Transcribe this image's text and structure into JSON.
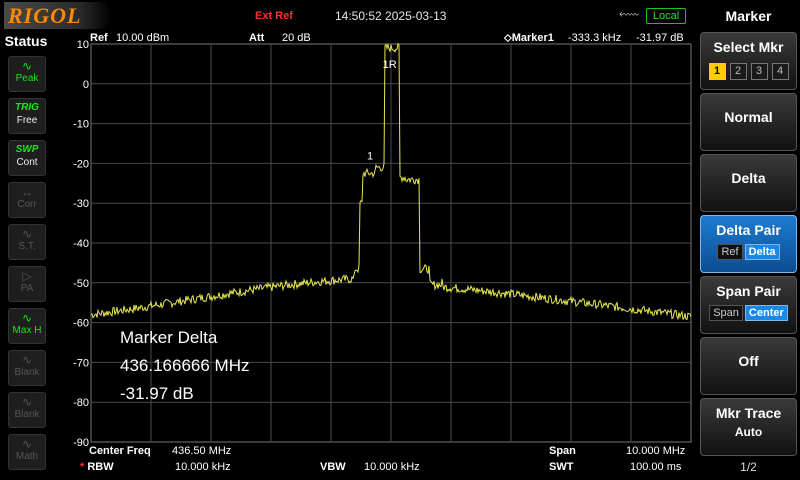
{
  "topbar": {
    "logo": "RIGOL",
    "ext_ref": "Ext Ref",
    "datetime": "14:50:52 2025-03-13",
    "usb_icon": "usb-icon",
    "local": "Local"
  },
  "status": {
    "title": "Status",
    "items": [
      {
        "icon": "peak-icon",
        "label": "Peak",
        "state": "on"
      },
      {
        "tag": "TRIG",
        "label": "Free"
      },
      {
        "tag": "SWP",
        "label": "Cont"
      },
      {
        "icon": "corr-icon",
        "label": "Corr",
        "state": "off"
      },
      {
        "icon": "st-icon",
        "label": "S.T.",
        "state": "off"
      },
      {
        "icon": "pa-icon",
        "label": "PA",
        "state": "off"
      },
      {
        "icon": "maxhold-icon",
        "label": "Max H",
        "state": "on"
      },
      {
        "icon": "blank-icon",
        "label": "Blank",
        "state": "off"
      },
      {
        "icon": "blank-icon",
        "label": "Blank",
        "state": "off"
      },
      {
        "icon": "math-icon",
        "label": "Math",
        "state": "off"
      }
    ]
  },
  "header": {
    "ref_label": "Ref",
    "ref_value": "10.00 dBm",
    "att_label": "Att",
    "att_value": "20 dB",
    "marker_label": "Marker1",
    "marker_freq": "-333.3 kHz",
    "marker_amp": "-31.97 dB"
  },
  "yaxis": {
    "ticks": [
      "10",
      "0",
      "-10",
      "-20",
      "-30",
      "-40",
      "-50",
      "-60",
      "-70",
      "-80",
      "-90"
    ],
    "ref_dbm": 10,
    "div_db": 10,
    "divisions": 10
  },
  "marker_delta": {
    "title": "Marker Delta",
    "freq": "436.166666 MHz",
    "amp": "-31.97 dB",
    "marker_label": "1",
    "ref_label": "1R"
  },
  "footer": {
    "center_label": "Center Freq",
    "center_value": "436.50 MHz",
    "span_label": "Span",
    "span_value": "10.000 MHz",
    "rbw_star": "*",
    "rbw_label": "RBW",
    "rbw_value": "10.000 kHz",
    "vbw_label": "VBW",
    "vbw_value": "10.000 kHz",
    "swt_label": "SWT",
    "swt_value": "100.00 ms"
  },
  "softkeys": {
    "title": "Marker",
    "select_mkr": "Select Mkr",
    "marker_numbers": [
      "1",
      "2",
      "3",
      "4"
    ],
    "selected_marker": "1",
    "normal": "Normal",
    "delta": "Delta",
    "delta_pair": "Delta Pair",
    "delta_pair_ref": "Ref",
    "delta_pair_delta": "Delta",
    "span_pair": "Span Pair",
    "span_pair_span": "Span",
    "span_pair_center": "Center",
    "off": "Off",
    "mkr_trace": "Mkr Trace",
    "mkr_trace_value": "Auto",
    "page": "1/2"
  },
  "colors": {
    "trace": "#e8e850",
    "grid": "#4a4a4a",
    "accent": "#1a88e6",
    "logo": "#ff8a00",
    "local": "#2ce02c"
  }
}
